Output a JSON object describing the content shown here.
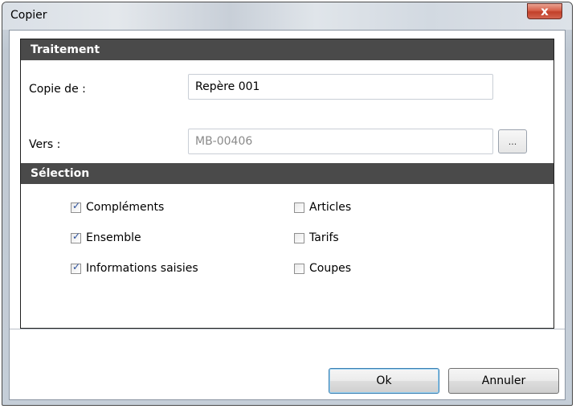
{
  "window": {
    "title": "Copier",
    "close_label": "x"
  },
  "traitement": {
    "header": "Traitement",
    "copie_de_label": "Copie de :",
    "copie_de_value": "Repère 001",
    "vers_label": "Vers :",
    "vers_value": "MB-00406",
    "browse_label": "..."
  },
  "selection": {
    "header": "Sélection",
    "items": [
      {
        "label": "Compléments",
        "checked": true
      },
      {
        "label": "Ensemble",
        "checked": true
      },
      {
        "label": "Informations saisies",
        "checked": true
      },
      {
        "label": "Articles",
        "checked": false
      },
      {
        "label": "Tarifs",
        "checked": false
      },
      {
        "label": "Coupes",
        "checked": false
      }
    ]
  },
  "buttons": {
    "ok": "Ok",
    "cancel": "Annuler"
  }
}
